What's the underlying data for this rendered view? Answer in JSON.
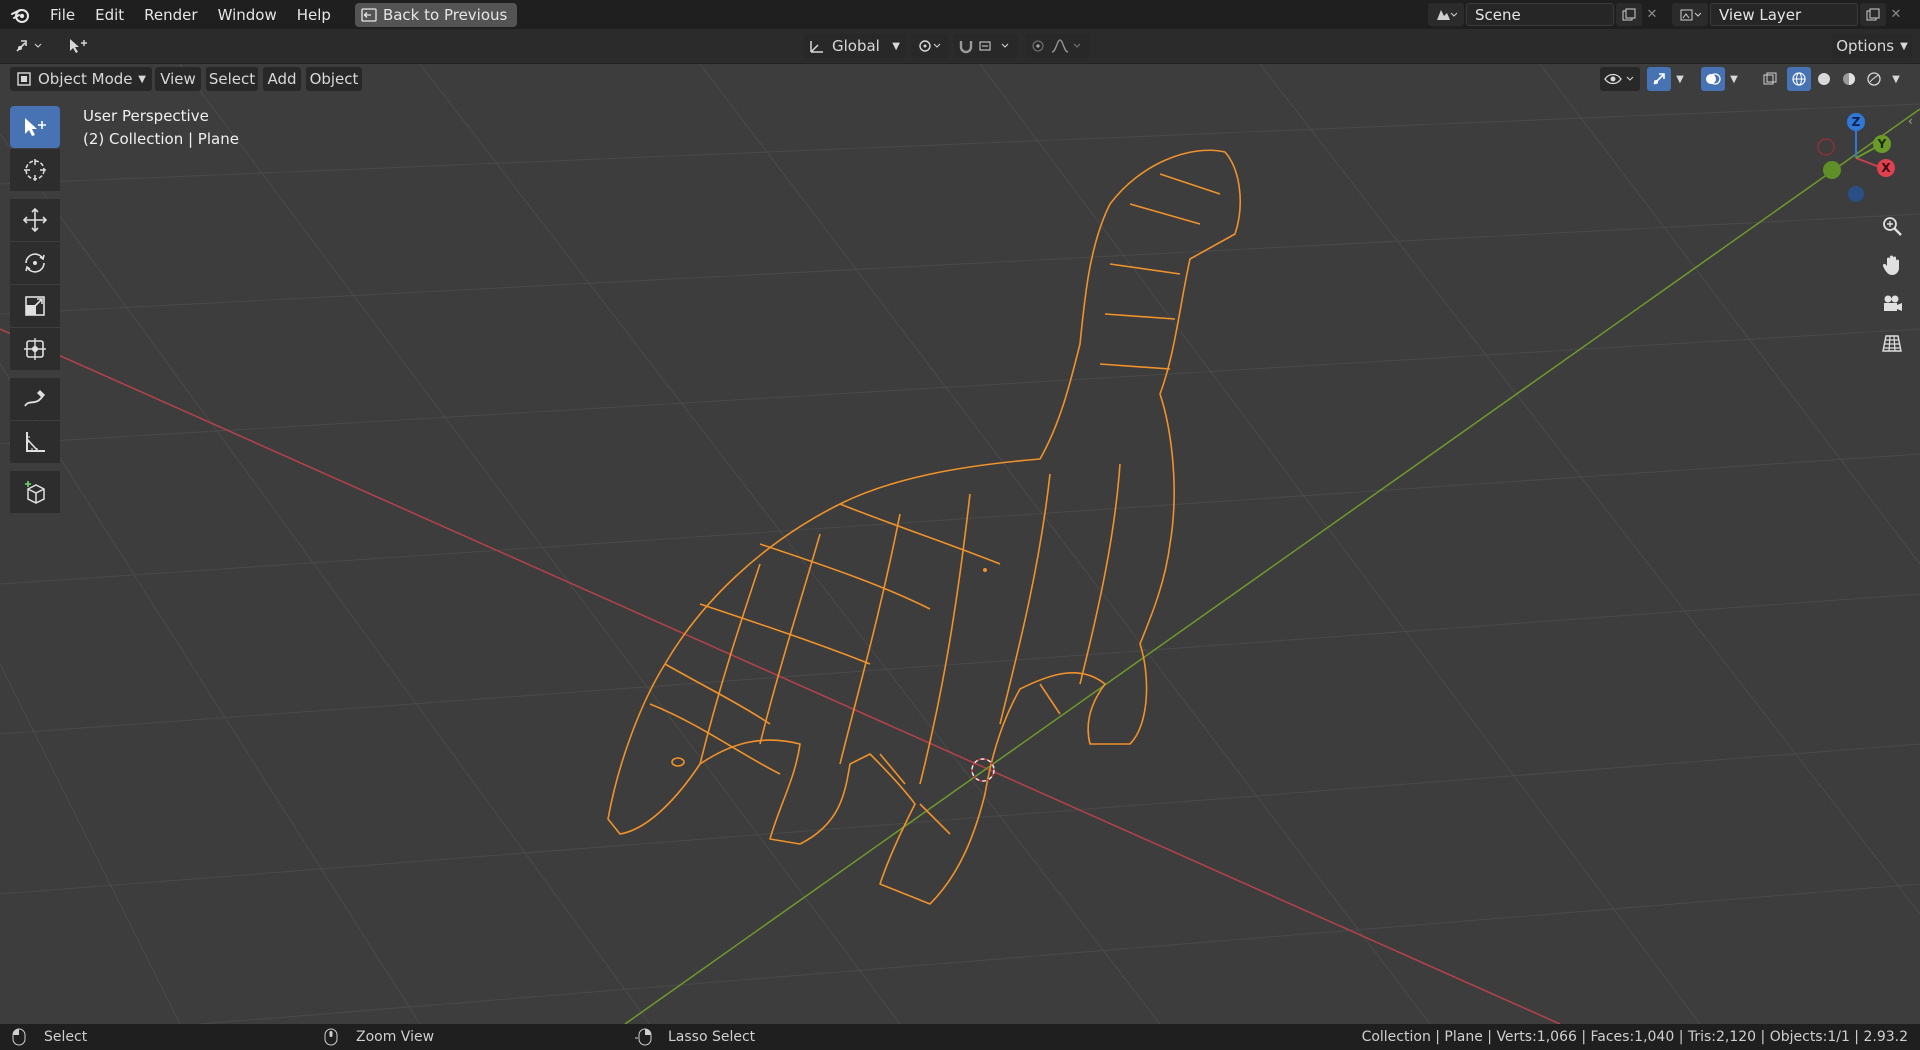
{
  "app": {
    "menus": [
      "File",
      "Edit",
      "Render",
      "Window",
      "Help"
    ],
    "back_button": "Back to Previous"
  },
  "scene": {
    "name": "Scene",
    "view_layer": "View Layer"
  },
  "header": {
    "orientation": "Global",
    "options_label": "Options",
    "mode": "Object Mode",
    "menus": [
      "View",
      "Select",
      "Add",
      "Object"
    ]
  },
  "viewport": {
    "title": "User Perspective",
    "collection_info": "(2) Collection | Plane",
    "gizmo": {
      "z": "Z",
      "y": "Y",
      "x": "X"
    }
  },
  "toolbar": {
    "tools": [
      "select-box",
      "cursor",
      "move",
      "rotate",
      "scale",
      "transform",
      "annotate",
      "measure",
      "add-cube"
    ]
  },
  "statusbar": {
    "select": "Select",
    "zoom": "Zoom View",
    "lasso": "Lasso Select",
    "stats": "Collection | Plane | Verts:1,066 | Faces:1,040 | Tris:2,120 | Objects:1/1 | 2.93.2"
  },
  "colors": {
    "background": "#3d3d3d",
    "topbar": "#1f1f1f",
    "accent": "#4772b3",
    "selection": "#f0922b",
    "x_axis": "#c8414e",
    "y_axis": "#6a9a2a",
    "z_axis": "#2f78d8"
  }
}
